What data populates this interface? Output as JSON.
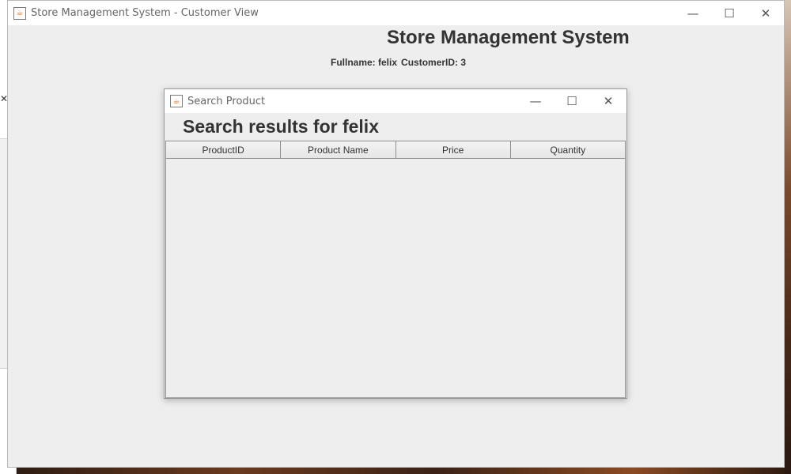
{
  "main_window": {
    "title": "Store Management System - Customer View",
    "heading": "Store Management System",
    "fullname_label": "Fullname: felix",
    "customer_label": "CustomerID: 3",
    "controls": {
      "minimize": "—",
      "maximize": "☐",
      "close": "✕"
    }
  },
  "dialog": {
    "title": "Search Product",
    "heading": "Search results for felix",
    "controls": {
      "minimize": "—",
      "maximize": "☐",
      "close": "✕"
    },
    "table": {
      "columns": [
        "ProductID",
        "Product Name",
        "Price",
        "Quantity"
      ],
      "rows": []
    }
  },
  "icons": {
    "app": "java-cup-icon"
  }
}
